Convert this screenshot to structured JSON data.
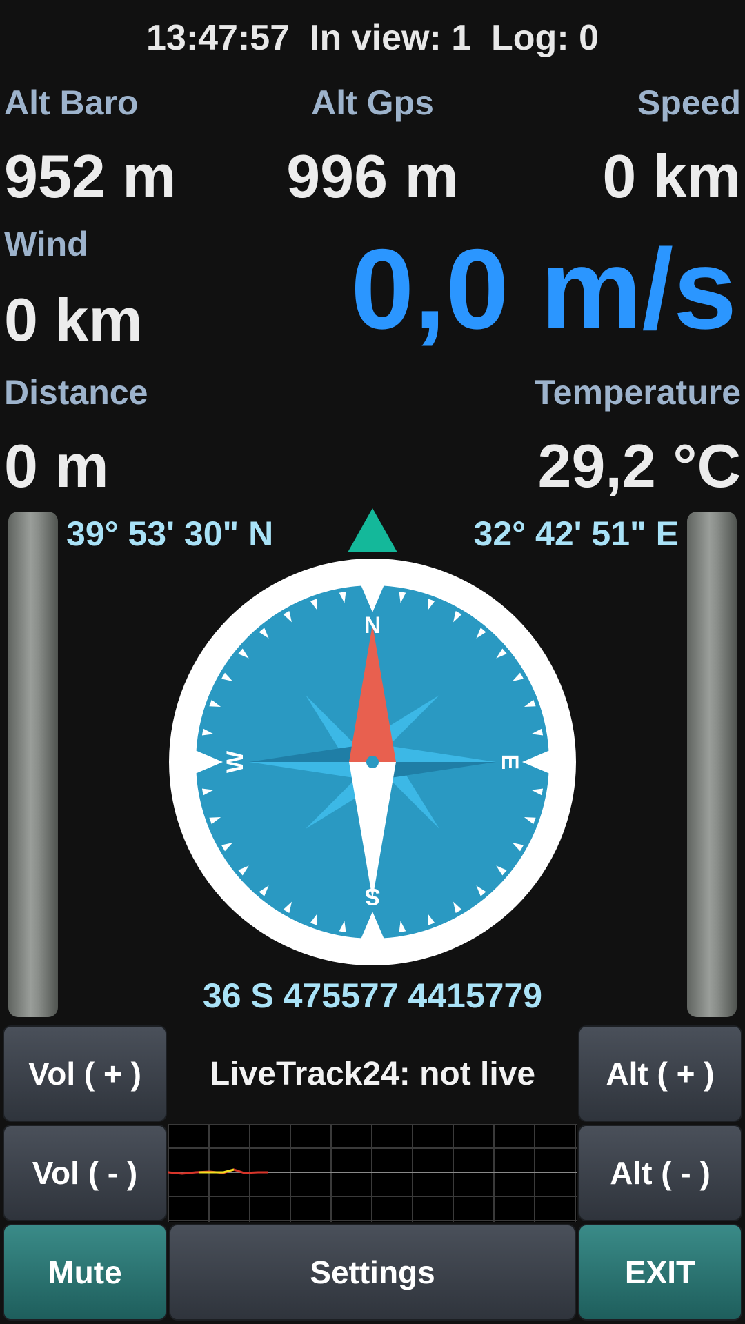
{
  "status": {
    "time": "13:47:57",
    "in_view": "In view: 1",
    "log": "Log: 0"
  },
  "alt_baro": {
    "label": "Alt Baro",
    "value": "952 m"
  },
  "alt_gps": {
    "label": "Alt Gps",
    "value": "996 m"
  },
  "speed": {
    "label": "Speed",
    "value": "0 km"
  },
  "wind": {
    "label": "Wind",
    "value": "0 km"
  },
  "vario": {
    "value": "0,0 m/s",
    "color": "#2b96ff"
  },
  "distance": {
    "label": "Distance",
    "value": "0 m"
  },
  "temperature": {
    "label": "Temperature",
    "value": "29,2 °C"
  },
  "position": {
    "lat": "39° 53' 30\" N",
    "lon": "32° 42' 51\" E",
    "utm": "36 S 475577 4415779"
  },
  "compass": {
    "n": "N",
    "e": "E",
    "s": "S",
    "w": "W",
    "heading_deg": 0,
    "dial_color": "#2a99c2",
    "needle_north_color": "#e8604f",
    "marker_color": "#14b89a"
  },
  "livetrack": "LiveTrack24: not live",
  "buttons": {
    "vol_up": "Vol ( + )",
    "vol_down": "Vol ( - )",
    "alt_up": "Alt ( + )",
    "alt_down": "Alt ( - )",
    "mute": "Mute",
    "settings": "Settings",
    "exit": "EXIT"
  }
}
